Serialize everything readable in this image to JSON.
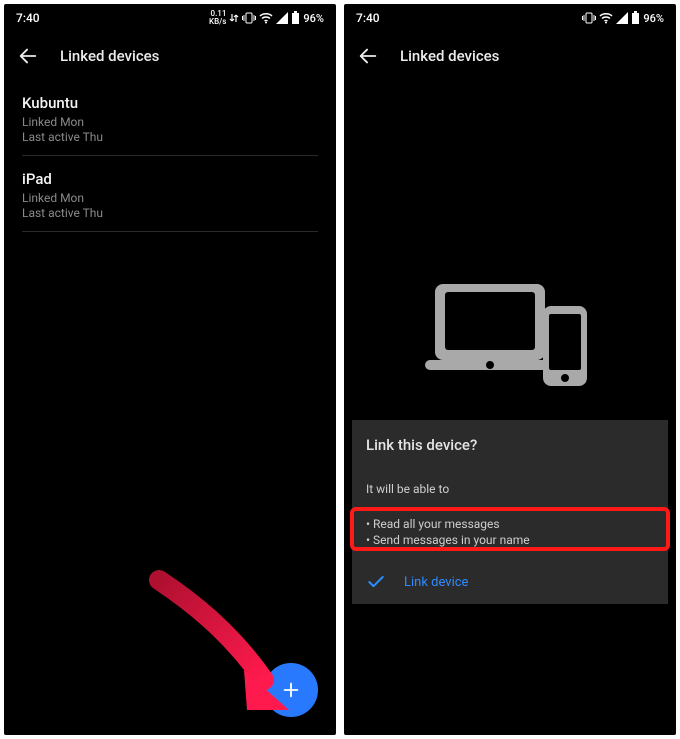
{
  "left": {
    "status": {
      "time": "7:40",
      "net_small": "0.11\nKB/s",
      "battery": "96%"
    },
    "appbar": {
      "title": "Linked devices"
    },
    "devices": [
      {
        "name": "Kubuntu",
        "linked": "Linked Mon",
        "active": "Last active Thu"
      },
      {
        "name": "iPad",
        "linked": "Linked Mon",
        "active": "Last active Thu"
      }
    ],
    "fab_label": "+"
  },
  "right": {
    "status": {
      "time": "7:40",
      "battery": "96%"
    },
    "appbar": {
      "title": "Linked devices"
    },
    "card": {
      "title": "Link this device?",
      "intro": "It will be able to",
      "b1": "• Read all your messages",
      "b2": "• Send messages in your name",
      "action": "Link device"
    }
  }
}
